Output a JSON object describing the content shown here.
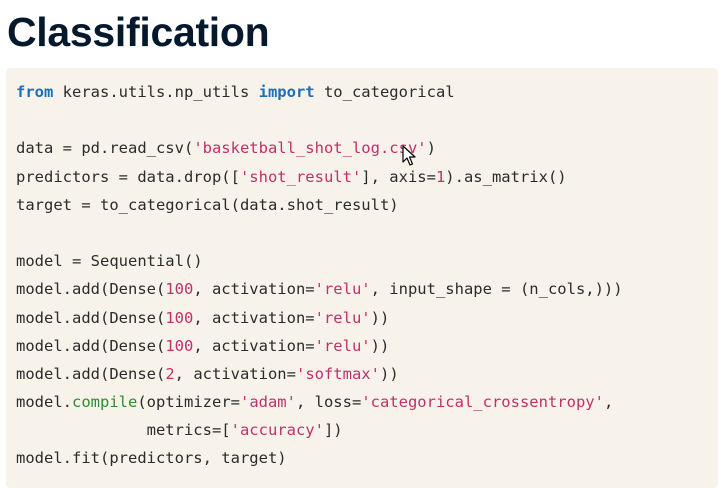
{
  "page": {
    "title": "Classification"
  },
  "code": {
    "lines": [
      [
        {
          "t": "from",
          "c": "kw"
        },
        {
          "t": " keras.utils.np_utils "
        },
        {
          "t": "import",
          "c": "kw"
        },
        {
          "t": " to_categorical"
        }
      ],
      [],
      [
        {
          "t": "data = pd.read_csv("
        },
        {
          "t": "'basketball_shot_log.csv'",
          "c": "str"
        },
        {
          "t": ")"
        }
      ],
      [
        {
          "t": "predictors = data.drop(["
        },
        {
          "t": "'shot_result'",
          "c": "str"
        },
        {
          "t": "], axis="
        },
        {
          "t": "1",
          "c": "num"
        },
        {
          "t": ").as_matrix()"
        }
      ],
      [
        {
          "t": "target = to_categorical(data.shot_result)"
        }
      ],
      [],
      [
        {
          "t": "model = Sequential()"
        }
      ],
      [
        {
          "t": "model.add(Dense("
        },
        {
          "t": "100",
          "c": "num"
        },
        {
          "t": ", activation="
        },
        {
          "t": "'relu'",
          "c": "str"
        },
        {
          "t": ", input_shape = (n_cols,)))"
        }
      ],
      [
        {
          "t": "model.add(Dense("
        },
        {
          "t": "100",
          "c": "num"
        },
        {
          "t": ", activation="
        },
        {
          "t": "'relu'",
          "c": "str"
        },
        {
          "t": "))"
        }
      ],
      [
        {
          "t": "model.add(Dense("
        },
        {
          "t": "100",
          "c": "num"
        },
        {
          "t": ", activation="
        },
        {
          "t": "'relu'",
          "c": "str"
        },
        {
          "t": "))"
        }
      ],
      [
        {
          "t": "model.add(Dense("
        },
        {
          "t": "2",
          "c": "num"
        },
        {
          "t": ", activation="
        },
        {
          "t": "'softmax'",
          "c": "str"
        },
        {
          "t": "))"
        }
      ],
      [
        {
          "t": "model."
        },
        {
          "t": "compile",
          "c": "fn"
        },
        {
          "t": "(optimizer="
        },
        {
          "t": "'adam'",
          "c": "str"
        },
        {
          "t": ", loss="
        },
        {
          "t": "'categorical_crossentropy'",
          "c": "str"
        },
        {
          "t": ","
        }
      ],
      [
        {
          "t": "              metrics=["
        },
        {
          "t": "'accuracy'",
          "c": "str"
        },
        {
          "t": "])"
        }
      ],
      [
        {
          "t": "model.fit(predictors, target)"
        }
      ]
    ]
  },
  "colors": {
    "title": "#05192d",
    "code_background": "#f7f3eb",
    "keyword": "#1e6fb8",
    "string": "#c0306a",
    "function": "#2e8b2e"
  },
  "icons": {
    "cursor": "mouse-pointer-icon"
  }
}
